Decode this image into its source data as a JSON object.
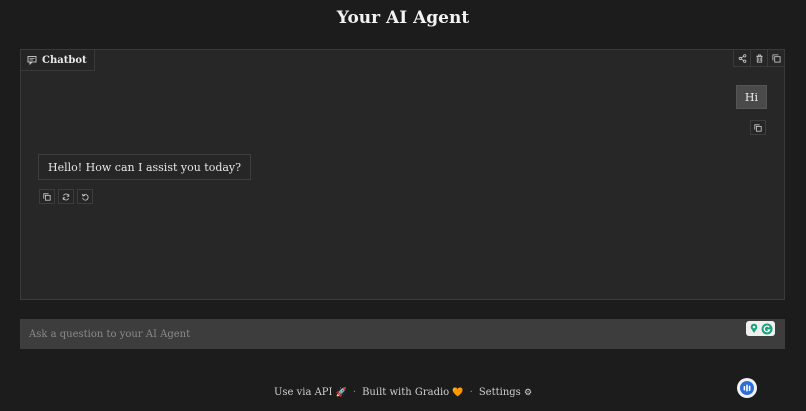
{
  "header": {
    "title": "Your AI Agent"
  },
  "chatbot": {
    "label": "Chatbot",
    "messages": [
      {
        "role": "user",
        "text": "Hi"
      },
      {
        "role": "assistant",
        "text": "Hello! How can I assist you today?"
      }
    ]
  },
  "input": {
    "placeholder": "Ask a question to your AI Agent",
    "value": ""
  },
  "footer": {
    "api_label": "Use via API",
    "api_emoji": "🚀",
    "separator": "·",
    "built_label": "Built with Gradio",
    "built_emoji": "🧡",
    "settings_label": "Settings",
    "settings_emoji": "⚙"
  },
  "colors": {
    "background": "#1c1c1c",
    "panel": "#272727",
    "input": "#3d3d3d",
    "badge_green": "#1aa37a"
  }
}
